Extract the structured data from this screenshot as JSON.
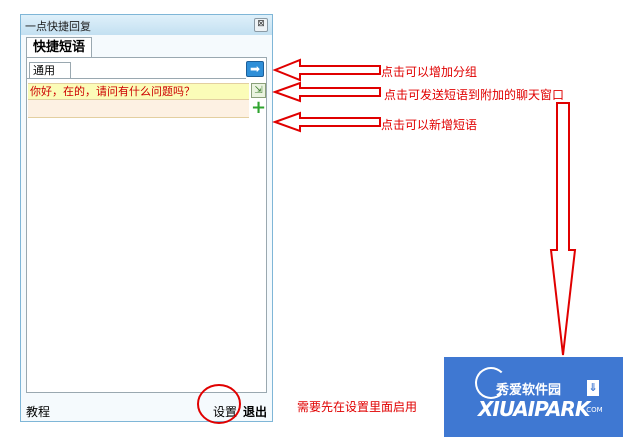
{
  "window": {
    "title": "一点快捷回复",
    "close_glyph": "⊠",
    "main_tab": "快捷短语",
    "group_tab": "通用",
    "add_group_glyph": "➡",
    "phrases": [
      "你好，在的，请问有什么问题吗？"
    ],
    "send_glyph": "⇲",
    "add_phrase_glyph": "+",
    "footer": {
      "tutorial": "教程",
      "settings": "设置",
      "exit": "退出"
    }
  },
  "annotations": {
    "add_group": "点击可以增加分组",
    "send_phrase": "点击可发送短语到附加的聊天窗口",
    "new_phrase": "点击可以新增短语",
    "enable_first": "需要先在设置里面启用"
  },
  "watermark": {
    "cn": "秀爱软件园",
    "en": "XIUAIPARK",
    "com": ".COM",
    "badge": "⇓"
  },
  "colors": {
    "annotation": "#e00000",
    "watermark_bg": "#3f78d2",
    "titlebar": "#c3e0f1"
  }
}
